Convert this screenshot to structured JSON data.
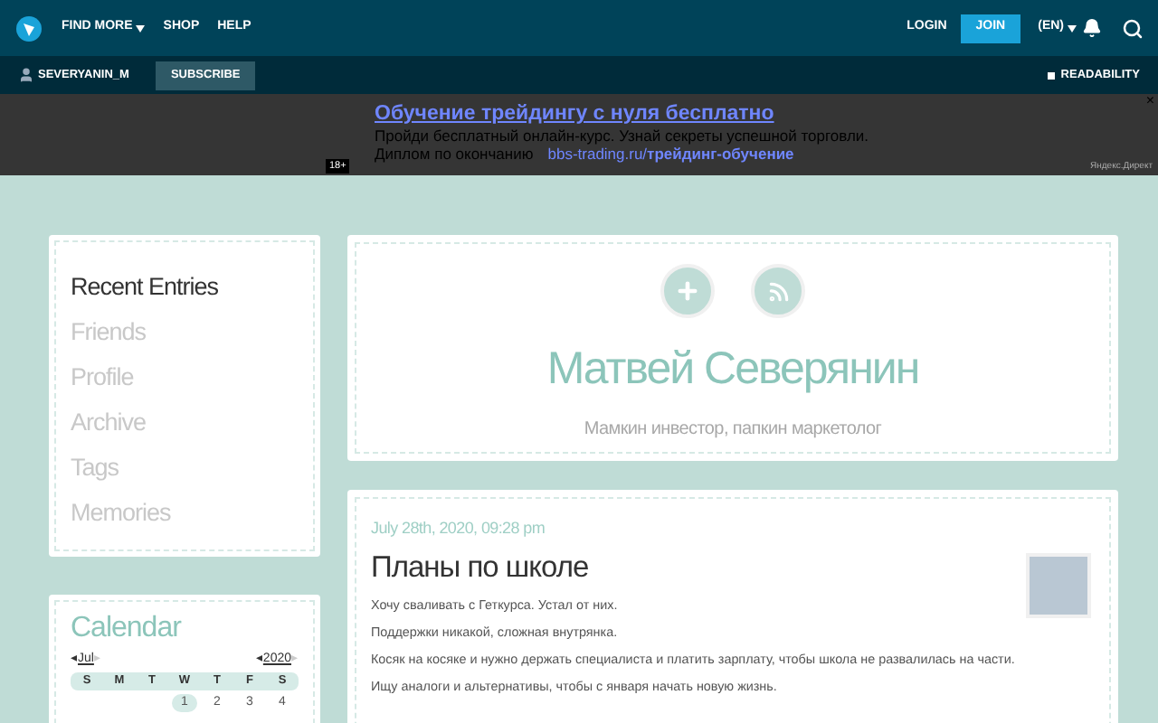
{
  "nav": {
    "menu": [
      {
        "label": "FIND MORE",
        "caret": true
      },
      {
        "label": "SHOP",
        "caret": false
      },
      {
        "label": "HELP",
        "caret": false
      }
    ],
    "login": "LOGIN",
    "join": "JOIN",
    "language": "(EN)"
  },
  "subbar": {
    "user": "SEVERYANIN_M",
    "subscribe": "SUBSCRIBE",
    "readability": "READABILITY"
  },
  "ad": {
    "title": "Обучение трейдингу с нуля бесплатно",
    "line1": "Пройди бесплатный онлайн-курс. Узнай секреты успешной торговли.",
    "line2": "Диплом по окончанию",
    "url_domain": "bbs-trading.ru/",
    "url_path": "трейдинг-обучение",
    "age": "18+",
    "source": "Яндекс.Директ",
    "close": "×"
  },
  "sidebar": {
    "items": [
      {
        "label": "Recent Entries",
        "selected": true
      },
      {
        "label": "Friends",
        "selected": false
      },
      {
        "label": "Profile",
        "selected": false
      },
      {
        "label": "Archive",
        "selected": false
      },
      {
        "label": "Tags",
        "selected": false
      },
      {
        "label": "Memories",
        "selected": false
      }
    ]
  },
  "calendar": {
    "title": "Calendar",
    "prev": "◂",
    "next": "▸",
    "month": "Jul",
    "year": "2020",
    "weekdays": [
      "S",
      "M",
      "T",
      "W",
      "T",
      "F",
      "S"
    ],
    "first_row": [
      {
        "day": "1",
        "selected": true
      },
      {
        "day": "2",
        "selected": false
      },
      {
        "day": "3",
        "selected": false
      },
      {
        "day": "4",
        "selected": false
      }
    ]
  },
  "profile": {
    "name": "Матвей Северянин",
    "tagline": "Мамкин инвестор, папкин маркетолог"
  },
  "post": {
    "date": "July 28th, 2020, 09:28 pm",
    "title": "Планы по школе",
    "paragraphs": [
      "Хочу сваливать с Геткурса. Устал от них.",
      "Поддержки никакой, сложная внутрянка.",
      "Косяк на косяке и нужно держать специалиста и платить зарплату, чтобы школа не развалилась на части.",
      "Ищу аналоги и альтернативы, чтобы с января начать новую жизнь."
    ]
  }
}
